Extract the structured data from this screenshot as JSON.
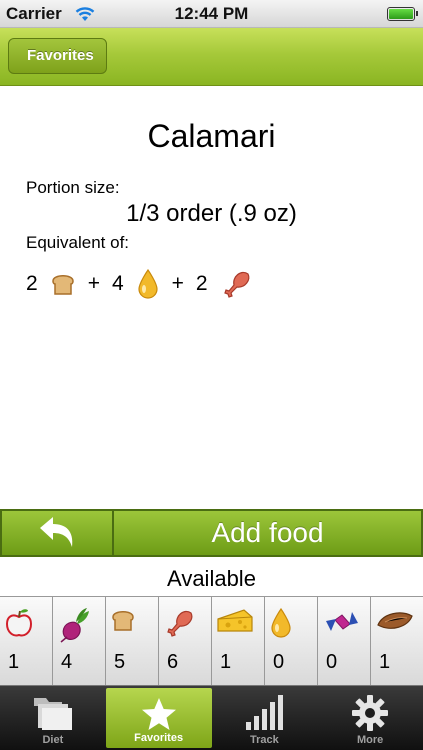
{
  "status_bar": {
    "carrier": "Carrier",
    "time": "12:44 PM",
    "battery_level": 1.0
  },
  "nav": {
    "back_label": "Favorites"
  },
  "food": {
    "name": "Calamari",
    "portion_label": "Portion size:",
    "portion_value": "1/3 order (.9 oz)",
    "equivalent_label": "Equivalent of:",
    "equivalents": [
      {
        "count": "2",
        "icon": "bread-icon"
      },
      {
        "count": "4",
        "icon": "oil-drop-icon"
      },
      {
        "count": "2",
        "icon": "drumstick-icon"
      }
    ],
    "plus": "+"
  },
  "actions": {
    "add_food_label": "Add food",
    "undo_icon": "undo-arrow-icon"
  },
  "available": {
    "title": "Available",
    "items": [
      {
        "icon": "apple-icon",
        "count": "1"
      },
      {
        "icon": "beet-icon",
        "count": "4"
      },
      {
        "icon": "bread-icon",
        "count": "5"
      },
      {
        "icon": "drumstick-icon",
        "count": "6"
      },
      {
        "icon": "cheese-icon",
        "count": "1"
      },
      {
        "icon": "oil-drop-icon",
        "count": "0"
      },
      {
        "icon": "candy-icon",
        "count": "0"
      },
      {
        "icon": "almond-icon",
        "count": "1"
      }
    ]
  },
  "tabs": [
    {
      "label": "Diet",
      "icon": "folder-icon",
      "active": false
    },
    {
      "label": "Favorites",
      "icon": "star-icon",
      "active": true
    },
    {
      "label": "Track",
      "icon": "bar-chart-icon",
      "active": false
    },
    {
      "label": "More",
      "icon": "gear-icon",
      "active": false
    }
  ],
  "colors": {
    "accent": "#8ab522",
    "tab_active": "#9cc63a",
    "tab_bar": "#1e1e1e"
  }
}
